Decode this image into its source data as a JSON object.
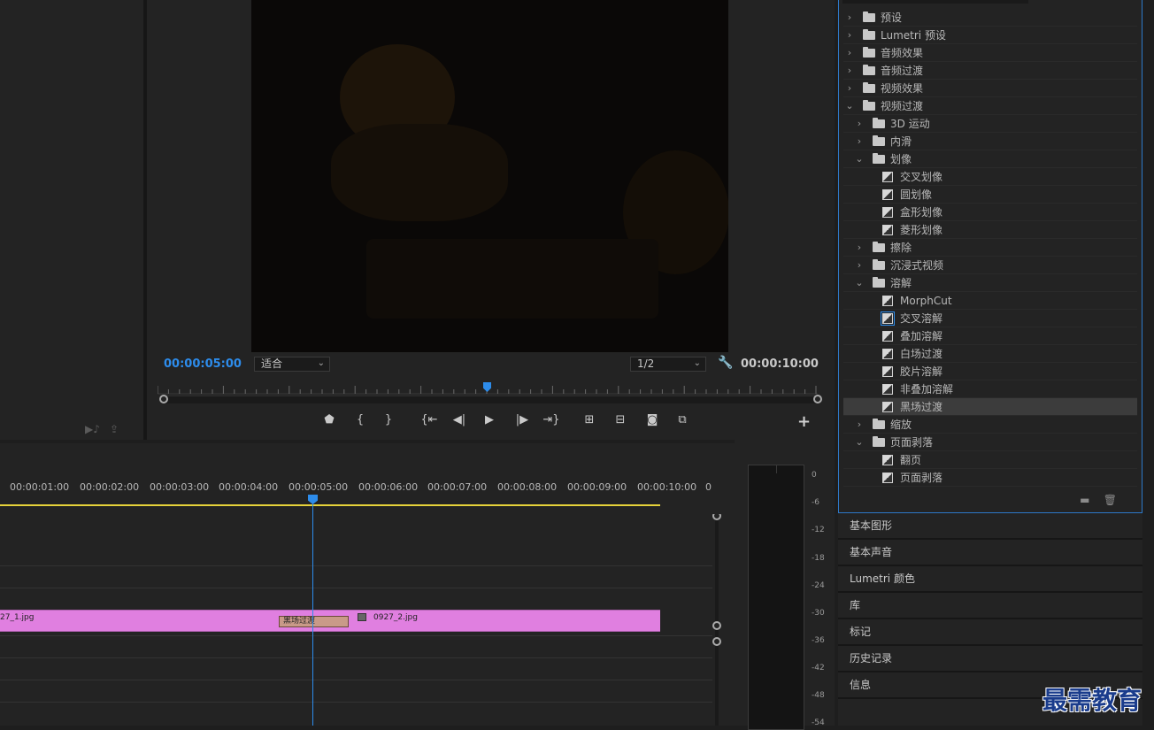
{
  "program_monitor": {
    "timecode_current": "00:00:05:00",
    "zoom_select": "适合",
    "resolution_select": "1/2",
    "timecode_duration": "00:00:10:00",
    "transport_icons": [
      "marker-icon",
      "mark-in-icon",
      "mark-out-icon",
      "go-to-in-icon",
      "step-back-icon",
      "play-icon",
      "step-forward-icon",
      "go-to-out-icon",
      "lift-icon",
      "extract-icon",
      "export-frame-icon",
      "comparison-view-icon"
    ],
    "add_button": "+"
  },
  "effects_panel": {
    "items": [
      {
        "label": "预设",
        "level": 0,
        "kind": "folder",
        "expanded": false
      },
      {
        "label": "Lumetri 预设",
        "level": 0,
        "kind": "folder",
        "expanded": false
      },
      {
        "label": "音频效果",
        "level": 0,
        "kind": "folder",
        "expanded": false
      },
      {
        "label": "音频过渡",
        "level": 0,
        "kind": "folder",
        "expanded": false
      },
      {
        "label": "视频效果",
        "level": 0,
        "kind": "folder",
        "expanded": false
      },
      {
        "label": "视频过渡",
        "level": 0,
        "kind": "folder",
        "expanded": true
      },
      {
        "label": "3D 运动",
        "level": 1,
        "kind": "folder",
        "expanded": false
      },
      {
        "label": "内滑",
        "level": 1,
        "kind": "folder",
        "expanded": false
      },
      {
        "label": "划像",
        "level": 1,
        "kind": "folder",
        "expanded": true
      },
      {
        "label": "交叉划像",
        "level": 2,
        "kind": "effect"
      },
      {
        "label": "圆划像",
        "level": 2,
        "kind": "effect"
      },
      {
        "label": "盒形划像",
        "level": 2,
        "kind": "effect"
      },
      {
        "label": "菱形划像",
        "level": 2,
        "kind": "effect"
      },
      {
        "label": "擦除",
        "level": 1,
        "kind": "folder",
        "expanded": false
      },
      {
        "label": "沉浸式视频",
        "level": 1,
        "kind": "folder",
        "expanded": false
      },
      {
        "label": "溶解",
        "level": 1,
        "kind": "folder",
        "expanded": true
      },
      {
        "label": "MorphCut",
        "level": 2,
        "kind": "effect"
      },
      {
        "label": "交叉溶解",
        "level": 2,
        "kind": "effect",
        "default": true
      },
      {
        "label": "叠加溶解",
        "level": 2,
        "kind": "effect"
      },
      {
        "label": "白场过渡",
        "level": 2,
        "kind": "effect"
      },
      {
        "label": "胶片溶解",
        "level": 2,
        "kind": "effect"
      },
      {
        "label": "非叠加溶解",
        "level": 2,
        "kind": "effect"
      },
      {
        "label": "黑场过渡",
        "level": 2,
        "kind": "effect",
        "selected": true
      },
      {
        "label": "缩放",
        "level": 1,
        "kind": "folder",
        "expanded": false
      },
      {
        "label": "页面剥落",
        "level": 1,
        "kind": "folder",
        "expanded": true
      },
      {
        "label": "翻页",
        "level": 2,
        "kind": "effect"
      },
      {
        "label": "页面剥落",
        "level": 2,
        "kind": "effect"
      }
    ]
  },
  "side_panels": [
    "基本图形",
    "基本声音",
    "Lumetri 颜色",
    "库",
    "标记",
    "历史记录",
    "信息"
  ],
  "timeline": {
    "ruler_labels": [
      "00:00:01:00",
      "00:00:02:00",
      "00:00:03:00",
      "00:00:04:00",
      "00:00:05:00",
      "00:00:06:00",
      "00:00:07:00",
      "00:00:08:00",
      "00:00:09:00",
      "00:00:10:00",
      "0"
    ],
    "clip1_name": "27_1.jpg",
    "transition_name": "黑场过渡",
    "clip2_name": "0927_2.jpg"
  },
  "audio_meter": {
    "scale": [
      "0",
      "-6",
      "-12",
      "-18",
      "-24",
      "-30",
      "-36",
      "-42",
      "-48",
      "-54"
    ]
  },
  "watermark": "最需教育",
  "colors": {
    "accent": "#2d8ceb",
    "clip": "#e07fe0",
    "work_area": "#e6d23a"
  }
}
